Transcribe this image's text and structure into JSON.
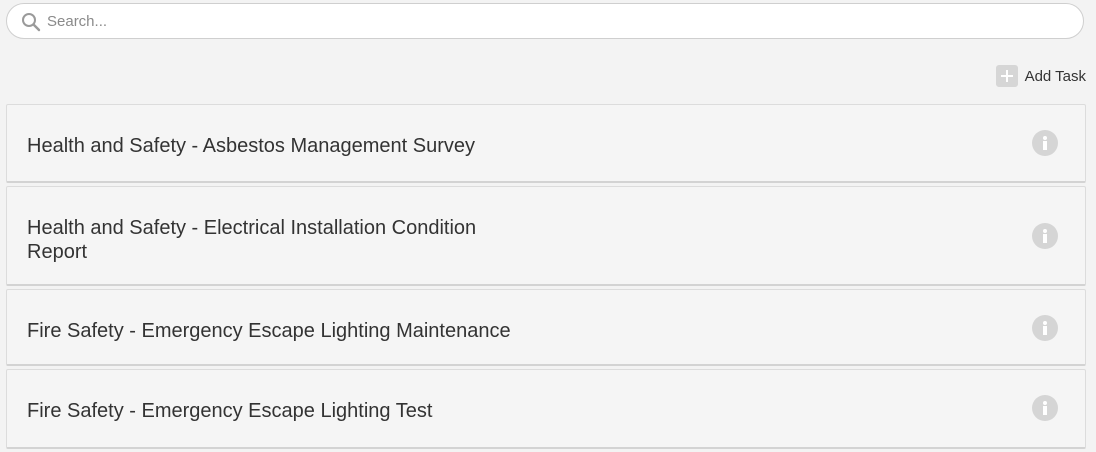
{
  "search": {
    "placeholder": "Search...",
    "value": ""
  },
  "toolbar": {
    "add_task_label": "Add Task"
  },
  "tasks": [
    {
      "title": "Health and Safety - Asbestos Management Survey"
    },
    {
      "title": "Health and Safety - Electrical Installation Condition Report"
    },
    {
      "title": "Fire Safety - Emergency Escape Lighting Maintenance"
    },
    {
      "title": "Fire Safety - Emergency Escape Lighting Test"
    }
  ],
  "colors": {
    "background": "#f3f3f3",
    "card": "#f5f5f5",
    "icon_grey": "#d5d5d5",
    "text": "#333333"
  },
  "icons": {
    "search": "search-icon",
    "add": "plus-icon",
    "info": "info-icon"
  }
}
